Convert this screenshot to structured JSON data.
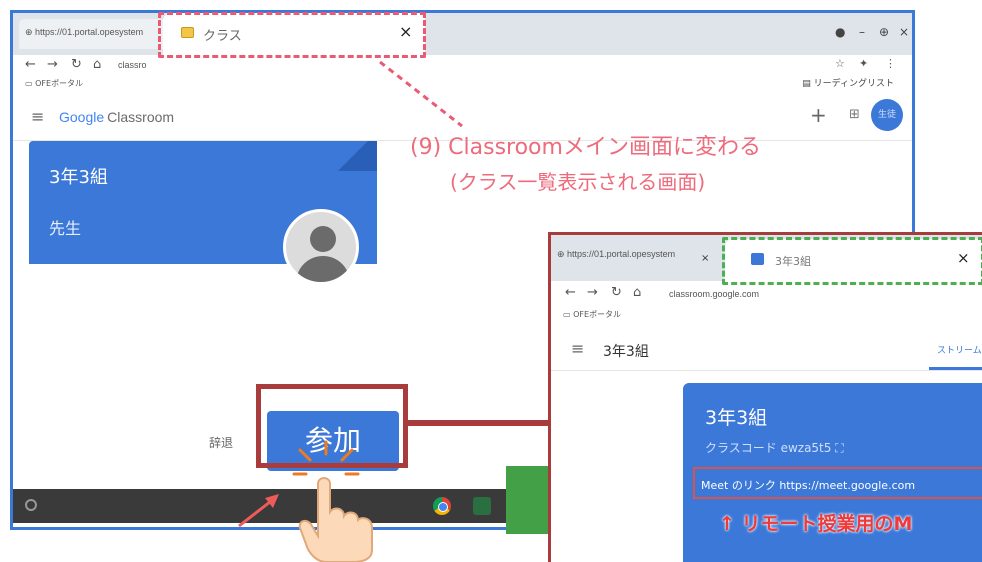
{
  "left_window": {
    "tab_inactive": "https://01.portal.opesystem",
    "tab_active": "クラス",
    "tab_close": "×",
    "window_controls": [
      "●",
      "–",
      "⊕",
      "×"
    ],
    "url": "classro",
    "bookmark": "OFEポータル",
    "reading_list": "リーディングリスト",
    "app_name_google": "Google",
    "app_name_classroom": "Classroom",
    "plus": "+",
    "apps": "⊞",
    "avatar": "生徒",
    "class_name": "3年3組",
    "teacher": "先生",
    "decline": "辞退",
    "join": "参加"
  },
  "captions": {
    "line1": "(9) Classroomメイン画面に変わる",
    "line2": "(クラス一覧表示される画面)"
  },
  "right_window": {
    "tab_inactive": "https://01.portal.opesystem",
    "tab_active": "3年3組",
    "tab_close": "×",
    "url": "classroom.google.com",
    "bookmark": "OFEポータル",
    "class_title": "3年3組",
    "stream_tab": "ストリーム",
    "banner_title": "3年3組",
    "class_code": "クラスコード ewza5t5 ⛶",
    "meet_link": "Meet のリンク  https://meet.google.com",
    "note": "↑ リモート授業用のM"
  },
  "colors": {
    "classroom_blue": "#3b78d8",
    "caption_pink": "#ee6b7c",
    "highlight_red": "#a83b3b",
    "arrow_green": "#43a047"
  }
}
